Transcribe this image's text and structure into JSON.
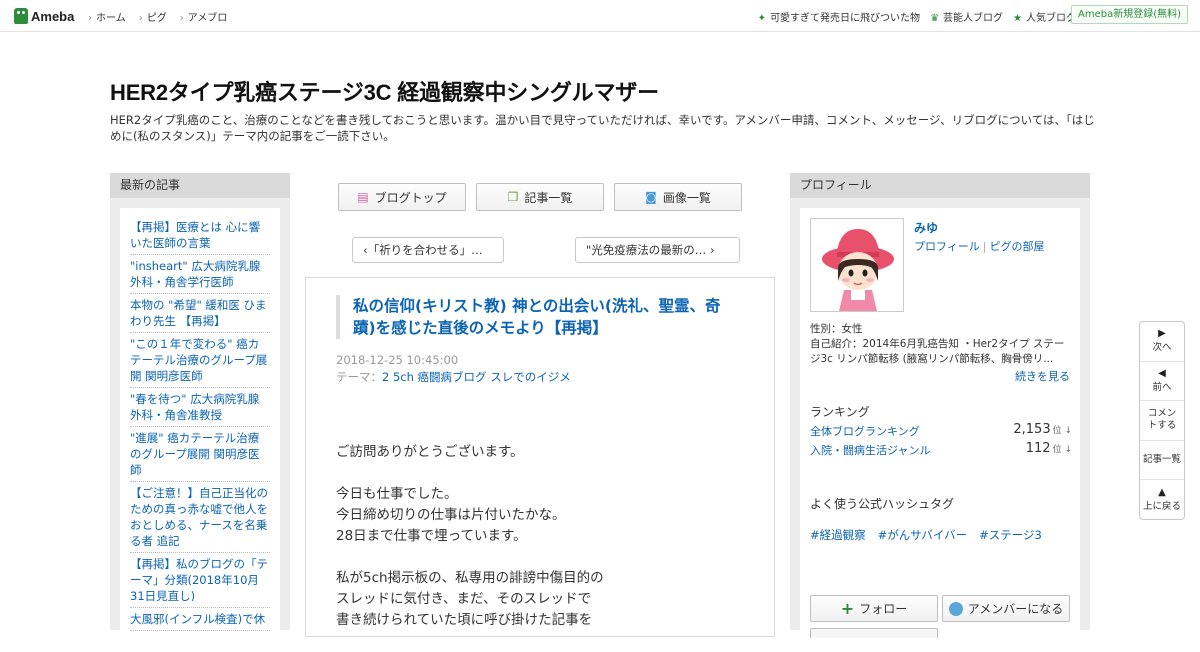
{
  "topbar": {
    "logo_text": "Ameba",
    "nav": [
      "ホーム",
      "ピグ",
      "アメブロ"
    ],
    "right_links": [
      {
        "icon": "sparkle-icon",
        "label": "可愛すぎて発売日に飛びついた物"
      },
      {
        "icon": "crown-icon",
        "label": "芸能人ブログ"
      },
      {
        "icon": "star-icon",
        "label": "人気ブログ"
      }
    ],
    "register_label": "Ameba新規登録(無料)"
  },
  "blog": {
    "title": "HER2タイプ乳癌ステージ3C 経過観察中シングルマザー",
    "description": "HER2タイプ乳癌のこと、治療のことなどを書き残しておこうと思います。温かい目で見守っていただければ、幸いです。アメンバー申請、コメント、メッセージ、リブログについては、「はじめに(私のスタンス)」テーマ内の記事をご一読下さい。"
  },
  "left_sidebar": {
    "heading": "最新の記事",
    "items": [
      "【再掲】医療とは 心に響いた医師の言葉",
      "\"insheart\" 広大病院乳腺外科・角舎学行医師",
      "本物の \"希望\" 緩和医 ひまわり先生 【再掲】",
      "\"この１年で変わる\" 癌カテーテル治療のグループ展開 関明彦医師",
      "\"春を待つ\" 広大病院乳腺外科・角舎准教授",
      "\"進展\" 癌カテーテル治療のグループ展開 関明彦医師",
      "【ご注意！】自己正当化のための真っ赤な嘘で他人をおとしめる、ナースを名乗る者 追記",
      "【再掲】私のブログの「テーマ」分類(2018年10月31日見直し)",
      "大風邪(インフル検査)で休"
    ]
  },
  "tabs": [
    {
      "icon": "blog-top-icon",
      "label": "ブログトップ"
    },
    {
      "icon": "article-list-icon",
      "label": "記事一覧"
    },
    {
      "icon": "camera-icon",
      "label": "画像一覧"
    }
  ],
  "pager": {
    "prev_label": "「祈りを合わせる」…",
    "next_label": "\"光免疫療法の最新の…"
  },
  "article": {
    "title": "私の信仰(キリスト教) 神との出会い(洗礼、聖霊、奇蹟)を感じた直後のメモより【再掲】",
    "date": "2018-12-25 10:45:00",
    "theme_prefix": "テーマ：",
    "theme": "2 5ch 癌闘病ブログ スレでのイジメ",
    "body": [
      "ご訪問ありがとうございます。",
      "今日も仕事でした。\n今日締め切りの仕事は片付いたかな。\n28日まで仕事で埋っています。",
      "私が5ch掲示板の、私専用の誹謗中傷目的の\nスレッドに気付き、まだ、そのスレッドで\n書き続けられていた頃に呼び掛けた記事を"
    ]
  },
  "right_sidebar": {
    "heading": "プロフィール",
    "name": "みゆ",
    "links": [
      "プロフィール",
      "ピグの部屋"
    ],
    "gender": "性別：女性",
    "intro": "自己紹介：2014年6月乳癌告知 ・Her2タイプ ステージ3c リンパ節転移 (腋窩リンパ節転移、胸骨傍リ...",
    "more": "続きを見る",
    "ranking_title": "ランキング",
    "rankings": [
      {
        "label": "全体ブログランキング",
        "value": "2,153",
        "unit": "位 ↓"
      },
      {
        "label": "入院・闘病生活ジャンル",
        "value": "112",
        "unit": "位 ↓"
      }
    ],
    "hashtag_title": "よく使う公式ハッシュタグ",
    "hashtags": [
      "#経過観察",
      "#がんサバイバー",
      "#ステージ3"
    ],
    "follow_label": "フォロー",
    "member_label": "アメンバーになる"
  },
  "float_nav": [
    {
      "icon": "triangle-right-icon",
      "label": "次へ"
    },
    {
      "icon": "triangle-left-icon",
      "label": "前へ"
    },
    {
      "icon": "",
      "label": "コメントする"
    },
    {
      "icon": "",
      "label": "記事一覧"
    },
    {
      "icon": "triangle-up-icon",
      "label": "上に戻る"
    }
  ]
}
